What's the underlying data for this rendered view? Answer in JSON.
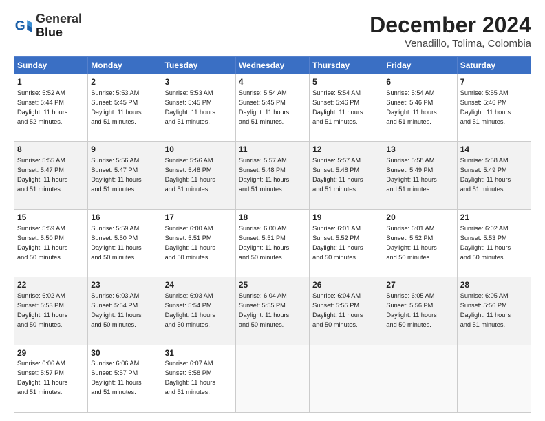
{
  "header": {
    "logo_line1": "General",
    "logo_line2": "Blue",
    "month": "December 2024",
    "location": "Venadillo, Tolima, Colombia"
  },
  "weekdays": [
    "Sunday",
    "Monday",
    "Tuesday",
    "Wednesday",
    "Thursday",
    "Friday",
    "Saturday"
  ],
  "weeks": [
    [
      {
        "day": "1",
        "info": "Sunrise: 5:52 AM\nSunset: 5:44 PM\nDaylight: 11 hours\nand 52 minutes."
      },
      {
        "day": "2",
        "info": "Sunrise: 5:53 AM\nSunset: 5:45 PM\nDaylight: 11 hours\nand 51 minutes."
      },
      {
        "day": "3",
        "info": "Sunrise: 5:53 AM\nSunset: 5:45 PM\nDaylight: 11 hours\nand 51 minutes."
      },
      {
        "day": "4",
        "info": "Sunrise: 5:54 AM\nSunset: 5:45 PM\nDaylight: 11 hours\nand 51 minutes."
      },
      {
        "day": "5",
        "info": "Sunrise: 5:54 AM\nSunset: 5:46 PM\nDaylight: 11 hours\nand 51 minutes."
      },
      {
        "day": "6",
        "info": "Sunrise: 5:54 AM\nSunset: 5:46 PM\nDaylight: 11 hours\nand 51 minutes."
      },
      {
        "day": "7",
        "info": "Sunrise: 5:55 AM\nSunset: 5:46 PM\nDaylight: 11 hours\nand 51 minutes."
      }
    ],
    [
      {
        "day": "8",
        "info": "Sunrise: 5:55 AM\nSunset: 5:47 PM\nDaylight: 11 hours\nand 51 minutes."
      },
      {
        "day": "9",
        "info": "Sunrise: 5:56 AM\nSunset: 5:47 PM\nDaylight: 11 hours\nand 51 minutes."
      },
      {
        "day": "10",
        "info": "Sunrise: 5:56 AM\nSunset: 5:48 PM\nDaylight: 11 hours\nand 51 minutes."
      },
      {
        "day": "11",
        "info": "Sunrise: 5:57 AM\nSunset: 5:48 PM\nDaylight: 11 hours\nand 51 minutes."
      },
      {
        "day": "12",
        "info": "Sunrise: 5:57 AM\nSunset: 5:48 PM\nDaylight: 11 hours\nand 51 minutes."
      },
      {
        "day": "13",
        "info": "Sunrise: 5:58 AM\nSunset: 5:49 PM\nDaylight: 11 hours\nand 51 minutes."
      },
      {
        "day": "14",
        "info": "Sunrise: 5:58 AM\nSunset: 5:49 PM\nDaylight: 11 hours\nand 51 minutes."
      }
    ],
    [
      {
        "day": "15",
        "info": "Sunrise: 5:59 AM\nSunset: 5:50 PM\nDaylight: 11 hours\nand 50 minutes."
      },
      {
        "day": "16",
        "info": "Sunrise: 5:59 AM\nSunset: 5:50 PM\nDaylight: 11 hours\nand 50 minutes."
      },
      {
        "day": "17",
        "info": "Sunrise: 6:00 AM\nSunset: 5:51 PM\nDaylight: 11 hours\nand 50 minutes."
      },
      {
        "day": "18",
        "info": "Sunrise: 6:00 AM\nSunset: 5:51 PM\nDaylight: 11 hours\nand 50 minutes."
      },
      {
        "day": "19",
        "info": "Sunrise: 6:01 AM\nSunset: 5:52 PM\nDaylight: 11 hours\nand 50 minutes."
      },
      {
        "day": "20",
        "info": "Sunrise: 6:01 AM\nSunset: 5:52 PM\nDaylight: 11 hours\nand 50 minutes."
      },
      {
        "day": "21",
        "info": "Sunrise: 6:02 AM\nSunset: 5:53 PM\nDaylight: 11 hours\nand 50 minutes."
      }
    ],
    [
      {
        "day": "22",
        "info": "Sunrise: 6:02 AM\nSunset: 5:53 PM\nDaylight: 11 hours\nand 50 minutes."
      },
      {
        "day": "23",
        "info": "Sunrise: 6:03 AM\nSunset: 5:54 PM\nDaylight: 11 hours\nand 50 minutes."
      },
      {
        "day": "24",
        "info": "Sunrise: 6:03 AM\nSunset: 5:54 PM\nDaylight: 11 hours\nand 50 minutes."
      },
      {
        "day": "25",
        "info": "Sunrise: 6:04 AM\nSunset: 5:55 PM\nDaylight: 11 hours\nand 50 minutes."
      },
      {
        "day": "26",
        "info": "Sunrise: 6:04 AM\nSunset: 5:55 PM\nDaylight: 11 hours\nand 50 minutes."
      },
      {
        "day": "27",
        "info": "Sunrise: 6:05 AM\nSunset: 5:56 PM\nDaylight: 11 hours\nand 50 minutes."
      },
      {
        "day": "28",
        "info": "Sunrise: 6:05 AM\nSunset: 5:56 PM\nDaylight: 11 hours\nand 51 minutes."
      }
    ],
    [
      {
        "day": "29",
        "info": "Sunrise: 6:06 AM\nSunset: 5:57 PM\nDaylight: 11 hours\nand 51 minutes."
      },
      {
        "day": "30",
        "info": "Sunrise: 6:06 AM\nSunset: 5:57 PM\nDaylight: 11 hours\nand 51 minutes."
      },
      {
        "day": "31",
        "info": "Sunrise: 6:07 AM\nSunset: 5:58 PM\nDaylight: 11 hours\nand 51 minutes."
      },
      null,
      null,
      null,
      null
    ]
  ]
}
